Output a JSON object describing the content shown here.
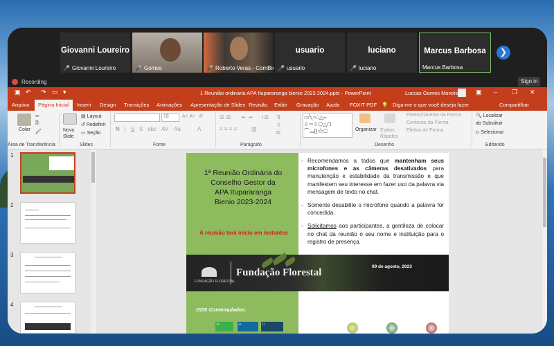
{
  "meeting": {
    "participants": [
      {
        "name": "Giovanni Loureiro",
        "caption": "Giovanni Loureiro",
        "video": false
      },
      {
        "name": "",
        "caption": "Gomes",
        "video": true
      },
      {
        "name": "",
        "caption": "Roberto Veras - ComBio",
        "video": true
      },
      {
        "name": "usuario",
        "caption": "usuario",
        "video": false
      },
      {
        "name": "luciano",
        "caption": "luciano",
        "video": false
      },
      {
        "name": "Marcus Barbosa",
        "caption": "Marcus Barbosa",
        "video": false
      }
    ],
    "recording_label": "Recording",
    "sign_in_label": "Sign in"
  },
  "powerpoint": {
    "document_title": "1 Reunião ordinaria APA Itupararanga bienio 2023 2024.pptx  -  PowerPoint",
    "user_name": "Luccas Gomes Moreira",
    "tabs": [
      "Arquivo",
      "Página Inicial",
      "Inserir",
      "Design",
      "Transições",
      "Animações",
      "Apresentação de Slides",
      "Revisão",
      "Exibir",
      "Gravação",
      "Ajuda",
      "FOXIT PDF"
    ],
    "active_tab": "Página Inicial",
    "tell_me": "Diga-me o que você deseja fazer",
    "share": "Compartilhar",
    "ribbon": {
      "paste": "Colar",
      "clipboard_group": "Área de Transferência",
      "new_slide": "Novo Slide",
      "layout": "Layout",
      "reset": "Redefinir",
      "section": "Seção",
      "slides_group": "Slides",
      "font_group": "Fonte",
      "paragraph_group": "Parágrafo",
      "organize": "Organizar",
      "quick_styles": "Estilos Rápidos",
      "shape_fill": "Preenchimento da Forma",
      "shape_outline": "Contorno da Forma",
      "shape_effects": "Efeitos de Forma",
      "drawing_group": "Desenho",
      "find": "Localizar",
      "replace": "Substituir",
      "select": "Selecionar",
      "editing_group": "Editando",
      "font_size": "18"
    },
    "thumbnails": [
      "1",
      "2",
      "3",
      "4"
    ],
    "selected_thumbnail": "1"
  },
  "slide": {
    "title_lines": [
      "1ª Reunião Ordinária do",
      "Conselho Gestor da",
      "APA Itupararanga",
      "Bienio 2023-2024"
    ],
    "alert": "A reunião terá início em instantes",
    "bullet1_pre": "Recomendamos a todos que ",
    "bullet1_bold": "mantenham seus microfones e as câmeras desativados",
    "bullet1_post": " para manutenção e estabilidade da transmissão e que manifestem seu interesse em fazer uso da palavra via mensagem de texto no chat.",
    "bullet2": "Somente desabilite o microfone quando a palavra for concedida.",
    "bullet3_underlined": "Solicitamos",
    "bullet3_rest": " aos participantes, a gentileza de colocar no chat da reunião o seu nome e instituição para o registro de presença.",
    "banner_name": "Fundação Florestal",
    "banner_logo_text": "FUNDAÇÃO FLORESTAL",
    "banner_date": "09 de agosto, 2023",
    "ods_label": "ODS Contemplados:",
    "ods_items": [
      "15",
      "16",
      "17"
    ],
    "colors": {
      "accent": "#c43e1c",
      "slide_green": "#8dbb5e",
      "alert_red": "#d61e1e"
    }
  }
}
